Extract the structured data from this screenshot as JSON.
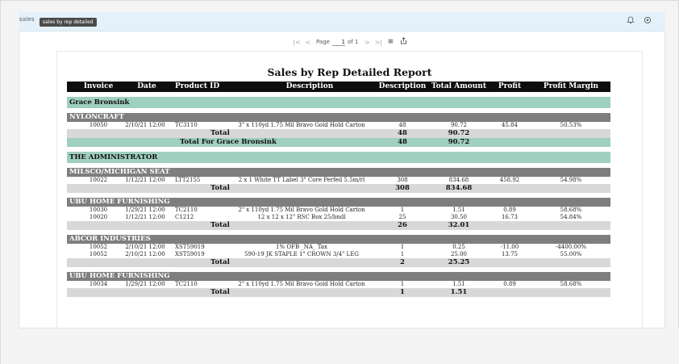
{
  "topbar": {
    "app_name": "sales",
    "tooltip": "sales by rep detailed",
    "bell_icon": "bell-icon",
    "settings_icon": "settings-icon"
  },
  "pager": {
    "first_icon": "first-page-icon",
    "prev_icon": "prev-page-icon",
    "page_label": "Page",
    "page_value": "1",
    "of_label": "of 1",
    "next_icon": "next-page-icon",
    "last_icon": "last-page-icon",
    "menu_icon": "menu-icon",
    "export_icon": "export-icon"
  },
  "report": {
    "title": "Sales by Rep Detailed Report",
    "columns": [
      "Invoice",
      "Date",
      "Product ID",
      "Description",
      "Description",
      "Total Amount",
      "Profit",
      "Profit Margin"
    ],
    "total_label": "Total",
    "reps": [
      {
        "name": "Grace Bronsink",
        "customers": [
          {
            "name": "NYLONCRAFT",
            "rows": [
              {
                "invoice": "10050",
                "date": "2/10/21 12:00",
                "product": "TC3110",
                "desc": "3\" x 110yd 1.75 Mil Bravo Gold Hold Carton",
                "qty": "48",
                "amount": "90.72",
                "profit": "45.84",
                "margin": "50.53%"
              }
            ],
            "total_qty": "48",
            "total_amount": "90.72"
          }
        ],
        "rep_total_label": "Total For Grace Bronsink",
        "rep_total_qty": "48",
        "rep_total_amount": "90.72"
      },
      {
        "name": "THE ADMINISTRATOR",
        "customers": [
          {
            "name": "MILSCO/MICHIGAN SEAT",
            "rows": [
              {
                "invoice": "10022",
                "date": "1/12/21 12:00",
                "product": "LTT2155",
                "desc": "2 x 1 White TT Label 3\" Core Perfed 5.5m/rl",
                "qty": "308",
                "amount": "834.68",
                "profit": "458.92",
                "margin": "54.98%"
              }
            ],
            "total_qty": "308",
            "total_amount": "834.68"
          },
          {
            "name": "UBU HOME FURNISHING",
            "rows": [
              {
                "invoice": "10030",
                "date": "1/29/21 12:00",
                "product": "TC2110",
                "desc": "2\" x 110yd 1.75 Mil Bravo Gold Hold Carton",
                "qty": "1",
                "amount": "1.51",
                "profit": "0.89",
                "margin": "58.68%"
              },
              {
                "invoice": "10020",
                "date": "1/12/21 12:00",
                "product": "C1212",
                "desc": "12 x 12 x 12\" RSC Box 25/bndl",
                "qty": "25",
                "amount": "30.50",
                "profit": "16.73",
                "margin": "54.84%"
              }
            ],
            "total_qty": "26",
            "total_amount": "32.01"
          },
          {
            "name": "ABCOR INDUSTRIES",
            "rows": [
              {
                "invoice": "10052",
                "date": "2/10/21 12:00",
                "product": "XST59019",
                "desc": "1% OFB _NA_ Tax",
                "qty": "1",
                "amount": "0.25",
                "profit": "-11.00",
                "margin": "-4400.00%"
              },
              {
                "invoice": "10052",
                "date": "2/10/21 12:00",
                "product": "XST59019",
                "desc": "590-19 JK STAPLE 1\" CROWN 3/4\" LEG",
                "qty": "1",
                "amount": "25.00",
                "profit": "13.75",
                "margin": "55.00%"
              }
            ],
            "total_qty": "2",
            "total_amount": "25.25"
          },
          {
            "name": "UBU HOME FURNISHING",
            "rows": [
              {
                "invoice": "10034",
                "date": "1/29/21 12:00",
                "product": "TC2110",
                "desc": "2\" x 110yd 1.75 Mil Bravo Gold Hold Carton",
                "qty": "1",
                "amount": "1.51",
                "profit": "0.89",
                "margin": "58.68%"
              }
            ],
            "total_qty": "1",
            "total_amount": "1.51"
          }
        ]
      }
    ]
  }
}
